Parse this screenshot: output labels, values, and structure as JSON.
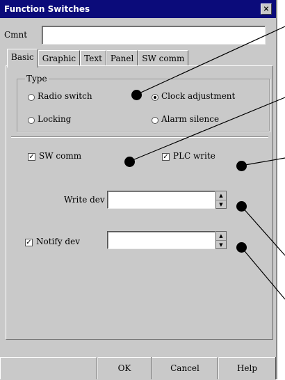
{
  "window": {
    "title": "Function Switches",
    "close_glyph": "×"
  },
  "comment": {
    "label": "Cmnt",
    "value": ""
  },
  "tabs": [
    {
      "label": "Basic",
      "active": true
    },
    {
      "label": "Graphic",
      "active": false
    },
    {
      "label": "Text",
      "active": false
    },
    {
      "label": "Panel",
      "active": false
    },
    {
      "label": "SW comm",
      "active": false
    }
  ],
  "type_group": {
    "title": "Type",
    "options": [
      {
        "label": "Radio switch",
        "selected": false
      },
      {
        "label": "Clock adjustment",
        "selected": true
      },
      {
        "label": "Locking",
        "selected": false
      },
      {
        "label": "Alarm silence",
        "selected": false
      }
    ]
  },
  "checkboxes": {
    "sw_comm": {
      "label": "SW comm",
      "checked": true
    },
    "plc_write": {
      "label": "PLC write",
      "checked": true
    },
    "notify_dev": {
      "label": "Notify dev",
      "checked": true
    }
  },
  "write_dev": {
    "label": "Write dev",
    "value": ""
  },
  "notify_dev_field": {
    "value": ""
  },
  "buttons": {
    "ok": "OK",
    "cancel": "Cancel",
    "help": "Help"
  },
  "check_glyph": "✓",
  "spin_up_glyph": "▲",
  "spin_down_glyph": "▼"
}
